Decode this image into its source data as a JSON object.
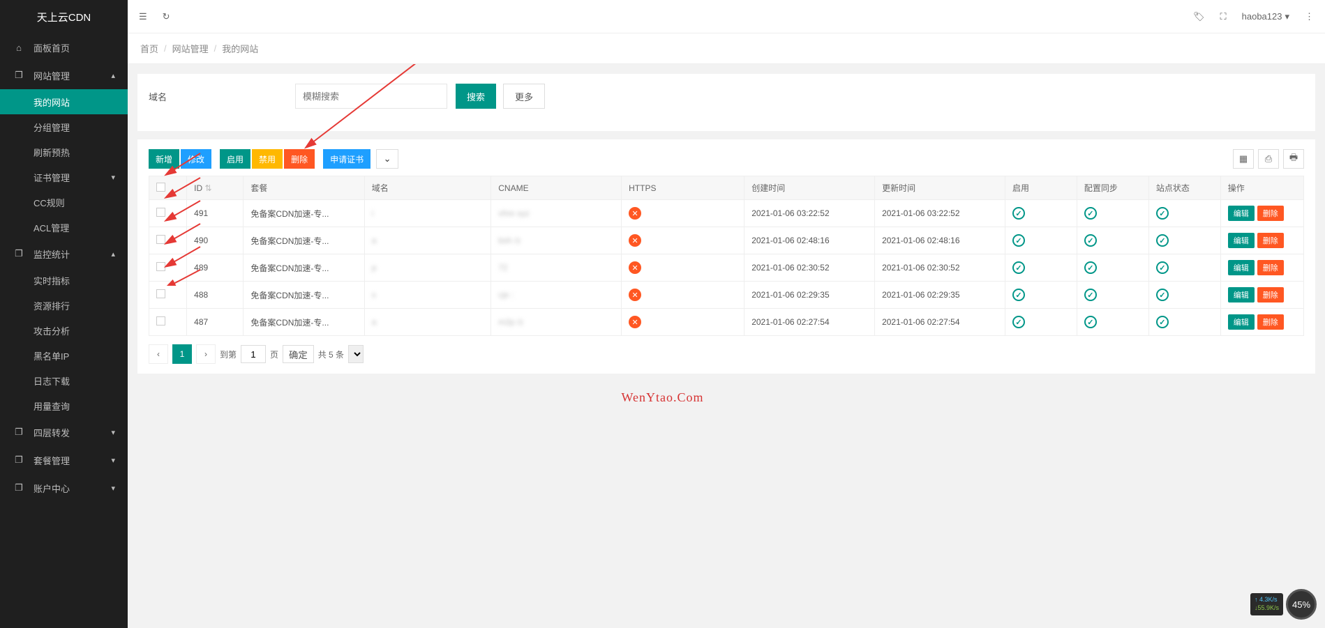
{
  "app_title": "天上云CDN",
  "user": "haoba123",
  "sidebar": {
    "dashboard": "面板首页",
    "site_mgmt": "网站管理",
    "items": [
      {
        "label": "我的网站",
        "active": true
      },
      {
        "label": "分组管理"
      },
      {
        "label": "刷新预热"
      },
      {
        "label": "证书管理",
        "arrow": "▾"
      },
      {
        "label": "CC规则"
      },
      {
        "label": "ACL管理"
      }
    ],
    "monitor": "监控统计",
    "monitor_items": [
      {
        "label": "实时指标"
      },
      {
        "label": "资源排行"
      },
      {
        "label": "攻击分析"
      },
      {
        "label": "黑名单IP"
      },
      {
        "label": "日志下载"
      },
      {
        "label": "用量查询"
      }
    ],
    "l4": "四层转发",
    "pkg": "套餐管理",
    "acct": "账户中心"
  },
  "breadcrumb": [
    "首页",
    "网站管理",
    "我的网站"
  ],
  "filter": {
    "label": "域名",
    "placeholder": "模糊搜索",
    "search": "搜索",
    "more": "更多"
  },
  "toolbar": {
    "add": "新增",
    "edit": "修改",
    "enable": "启用",
    "disable": "禁用",
    "delete": "删除",
    "cert": "申请证书"
  },
  "columns": {
    "id": "ID",
    "pkg": "套餐",
    "domain": "域名",
    "cname": "CNAME",
    "https": "HTTPS",
    "ctime": "创建时间",
    "utime": "更新时间",
    "enable": "启用",
    "sync": "配置同步",
    "status": "站点状态",
    "op": "操作"
  },
  "rows": [
    {
      "id": "491",
      "pkg": "免备案CDN加速-专...",
      "domain": "i",
      "cname": "vhre         xyz",
      "ctime": "2021-01-06 03:22:52",
      "utime": "2021-01-06 03:22:52"
    },
    {
      "id": "490",
      "pkg": "免备案CDN加速-专...",
      "domain": "a",
      "cname": "bsh          /z",
      "ctime": "2021-01-06 02:48:16",
      "utime": "2021-01-06 02:48:16"
    },
    {
      "id": "489",
      "pkg": "免备案CDN加速-专...",
      "domain": "p",
      "cname": "72",
      "ctime": "2021-01-06 02:30:52",
      "utime": "2021-01-06 02:30:52"
    },
    {
      "id": "488",
      "pkg": "免备案CDN加速-专...",
      "domain": "s",
      "cname": "cje          :",
      "ctime": "2021-01-06 02:29:35",
      "utime": "2021-01-06 02:29:35"
    },
    {
      "id": "487",
      "pkg": "免备案CDN加速-专...",
      "domain": "a",
      "cname": "m2p          /z",
      "ctime": "2021-01-06 02:27:54",
      "utime": "2021-01-06 02:27:54"
    }
  ],
  "op": {
    "edit": "编辑",
    "delete": "删除"
  },
  "pager": {
    "goto": "到第",
    "page_unit": "页",
    "confirm": "确定",
    "total": "共 5 条",
    "current": "1"
  },
  "watermark": "WenYtao.Com",
  "netmon": {
    "up": "↑ 4.3K/s",
    "dn": "↓55.9K/s",
    "pct": "45%"
  }
}
